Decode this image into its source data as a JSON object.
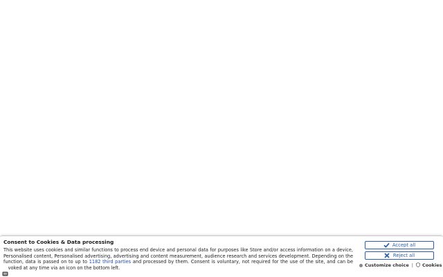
{
  "consent": {
    "title": "Consent to Cookies & Data processing",
    "text_before_link": "This website uses cookies and similar functions to process end device and personal data for purposes like Store and/or access information on a device, Personalised content, Personalised advertising, advertising and content measurement, audience research and services development. Depending on the function, data is passed on to up to ",
    "link_label": "1182 third parties",
    "text_after_link": " and processed by them. Consent is voluntary, not required for the use of the site, and can be revoked at any time via an icon on the bottom left.",
    "accept_label": "Accept all",
    "reject_label": "Reject all",
    "customize_label": "Customize choice",
    "separator": "|",
    "cookies_label": "Cookies"
  },
  "colors": {
    "accent": "#2a5caa",
    "link": "#1f4aa8"
  },
  "icons": {
    "accept": "check-icon",
    "reject": "x-icon",
    "customize": "gear-icon",
    "cookies": "shield-icon",
    "floating": "cookie-settings-icon"
  }
}
